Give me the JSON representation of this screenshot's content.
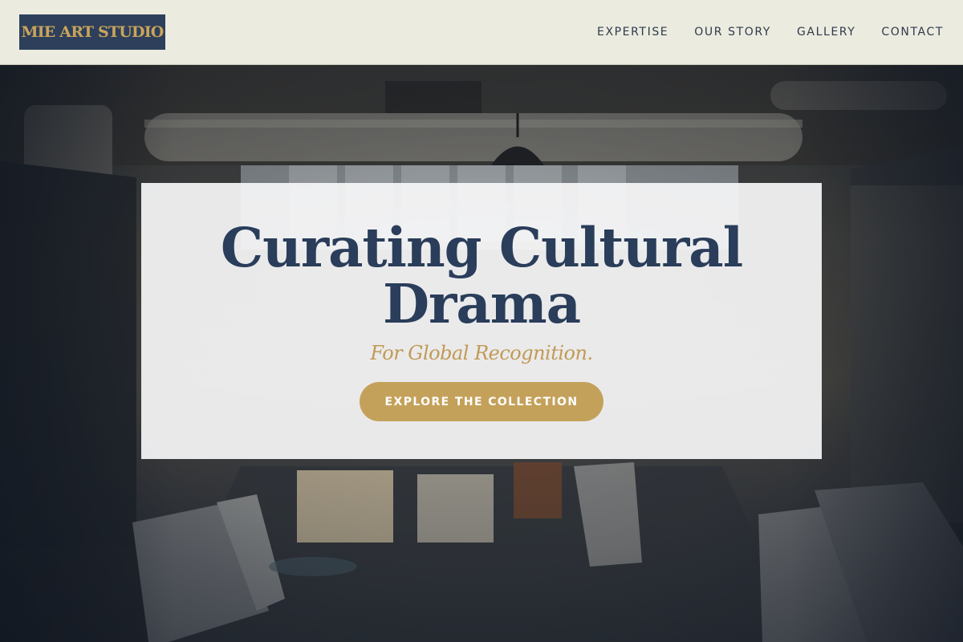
{
  "header": {
    "logo_text": "MIE ART STUDIO",
    "nav": [
      {
        "label": "EXPERTISE"
      },
      {
        "label": "OUR STORY"
      },
      {
        "label": "GALLERY"
      },
      {
        "label": "CONTACT"
      }
    ]
  },
  "hero": {
    "title": "Curating Cultural Drama",
    "subtitle": "For Global Recognition.",
    "cta_label": "EXPLORE THE COLLECTION",
    "background_image": "art-studio-warehouse-interior"
  },
  "colors": {
    "header_bg": "#ebebe0",
    "logo_bg": "#2d3f5a",
    "logo_text": "#c9a45c",
    "title": "#2a3d5a",
    "accent_gold": "#c4a15a",
    "nav_text": "#2f3a4a"
  }
}
